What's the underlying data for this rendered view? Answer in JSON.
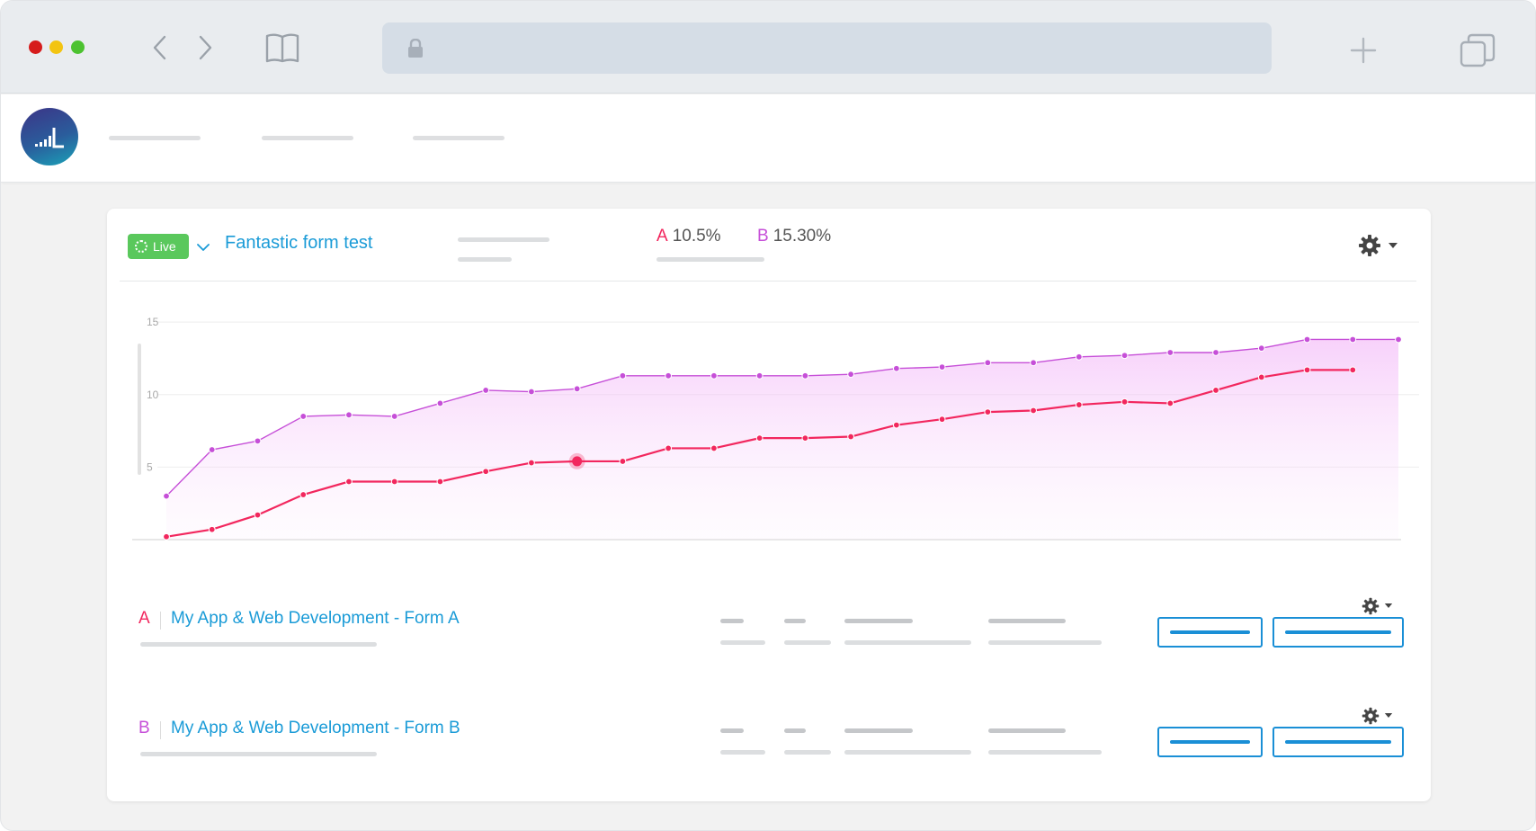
{
  "browser": {
    "traffic_colors": {
      "close": "#d61c1c",
      "minimize": "#f3c411",
      "zoom": "#4cc230"
    },
    "icons": [
      "back-chevron-icon",
      "forward-chevron-icon",
      "bookmarks-icon",
      "lock-icon",
      "new-tab-icon",
      "tabs-overview-icon"
    ],
    "url": ""
  },
  "app": {
    "logo_icon": "bar-chart-logo-icon"
  },
  "test": {
    "status_label": "Live",
    "title": "Fantastic form test",
    "variant_a_letter": "A",
    "variant_a_rate": "10.5%",
    "variant_b_letter": "B",
    "variant_b_rate": "15.30%"
  },
  "colors": {
    "accent": "#1a9bd7",
    "variant_a": "#f2275e",
    "variant_b": "#c64fd8",
    "live": "#5ac85c"
  },
  "chart_data": {
    "type": "line",
    "y_ticks": [
      5,
      10,
      15
    ],
    "ylim": [
      0,
      16
    ],
    "x": [
      1,
      2,
      3,
      4,
      5,
      6,
      7,
      8,
      9,
      10,
      11,
      12,
      13,
      14,
      15,
      16,
      17,
      18,
      19,
      20,
      21,
      22,
      23,
      24,
      25,
      26,
      27,
      28
    ],
    "series": [
      {
        "key": "B",
        "color": "#c64fd8",
        "values": [
          3.0,
          6.2,
          6.8,
          8.5,
          8.6,
          8.5,
          9.4,
          10.3,
          10.2,
          10.4,
          11.3,
          11.3,
          11.3,
          11.3,
          11.3,
          11.4,
          11.8,
          11.9,
          12.2,
          12.2,
          12.6,
          12.7,
          12.9,
          12.9,
          13.2,
          13.8,
          13.8,
          13.8
        ]
      },
      {
        "key": "A",
        "color": "#f2275e",
        "values": [
          0.2,
          0.7,
          1.7,
          3.1,
          4.0,
          4.0,
          4.0,
          4.7,
          5.3,
          5.4,
          5.4,
          6.3,
          6.3,
          7.0,
          7.0,
          7.1,
          7.9,
          8.3,
          8.8,
          8.9,
          9.3,
          9.5,
          9.4,
          10.3,
          11.2,
          11.7,
          11.7
        ]
      }
    ],
    "highlight": {
      "series": "A",
      "index": 9
    }
  },
  "variants": [
    {
      "letter": "A",
      "name": "My App & Web Development - Form A",
      "color": "#f2275e"
    },
    {
      "letter": "B",
      "name": "My App & Web Development - Form B",
      "color": "#c64fd8"
    }
  ]
}
